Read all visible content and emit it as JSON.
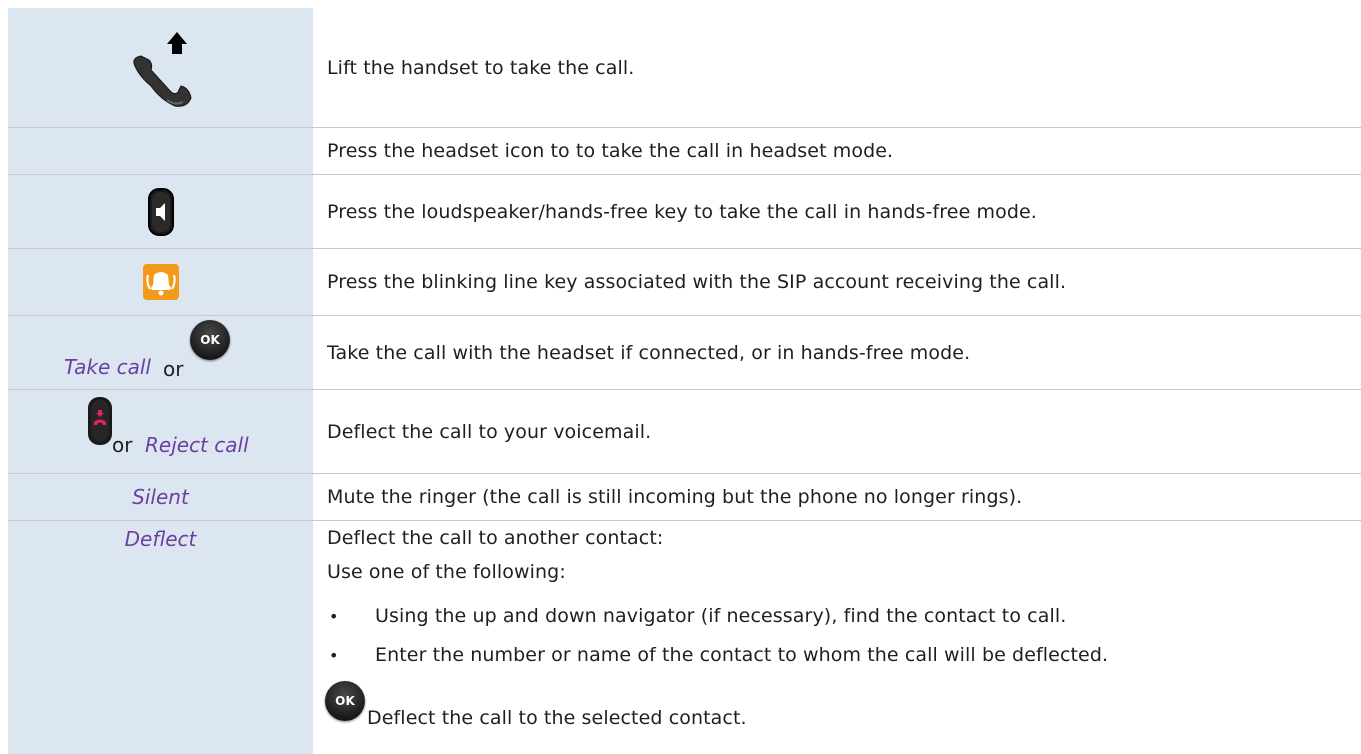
{
  "rows": [
    {
      "desc": "Lift the handset to take the call."
    },
    {
      "desc": "Press the headset icon to  to take the call in headset mode."
    },
    {
      "desc": "Press the loudspeaker/hands-free key to take the call in hands-free mode."
    },
    {
      "desc": "Press the blinking line key associated with the SIP account receiving the call."
    },
    {
      "left_italic": "Take call",
      "left_or": "or",
      "ok_label": "OK",
      "desc": "Take the call with the headset if connected, or in hands-free mode."
    },
    {
      "left_or": "or",
      "left_italic": "Reject call",
      "desc": "Deflect the call to your voicemail."
    },
    {
      "left_italic": "Silent",
      "desc": "Mute the ringer (the call is still incoming but the phone no longer rings)."
    },
    {
      "left_italic": "Deflect",
      "desc": "Deflect the call to another contact:",
      "sub": "Use one of the following:",
      "bullets": [
        "Using the up and down navigator (if necessary), find the contact to call.",
        "Enter the number or name of the contact to whom the call will be deflected."
      ],
      "ok_label": "OK",
      "final": "Deflect the call to the selected contact."
    }
  ],
  "colors": {
    "left_bg": "#dce6f1",
    "italic_text": "#6b3fa0",
    "end_call_red": "#e0245e",
    "line_key_orange": "#f39a1c"
  },
  "icons": [
    "handset-lift-icon",
    "speaker-key-icon",
    "line-key-icon",
    "ok-button-icon",
    "end-call-key-icon"
  ]
}
